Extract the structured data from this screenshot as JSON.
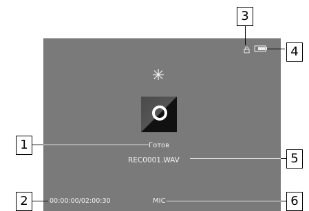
{
  "device_screen": {
    "status_text": "Готов",
    "filename": "REC0001.WAV",
    "time_counter": "00:00:00/02:00:30",
    "input_source": "MIC",
    "icons": {
      "activity": "sparkle-icon",
      "recording": "record-ring-icon",
      "lock": "lock-icon",
      "battery": "battery-icon"
    }
  },
  "callouts": {
    "c1": "1",
    "c2": "2",
    "c3": "3",
    "c4": "4",
    "c5": "5",
    "c6": "6"
  },
  "colors": {
    "screen_bg": "#7a7a7a",
    "text": "#f2f2f2"
  }
}
